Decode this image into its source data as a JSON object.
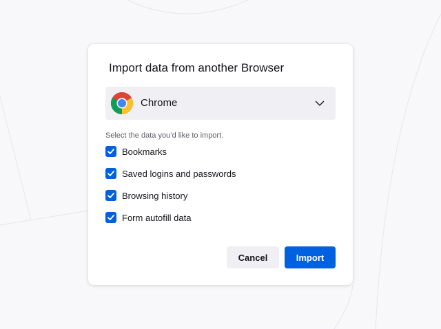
{
  "dialog": {
    "title": "Import data from another Browser",
    "browser_select": {
      "selected": "Chrome",
      "icon": "chrome-logo-icon"
    },
    "prompt": "Select the data you’d like to import.",
    "options": [
      {
        "label": "Bookmarks",
        "checked": true
      },
      {
        "label": "Saved logins and passwords",
        "checked": true
      },
      {
        "label": "Browsing history",
        "checked": true
      },
      {
        "label": "Form autofill data",
        "checked": true
      }
    ],
    "buttons": {
      "cancel": "Cancel",
      "import": "Import"
    }
  },
  "colors": {
    "accent": "#0061e0",
    "background": "#f8f8fa",
    "select_bg": "#f0f0f4"
  }
}
